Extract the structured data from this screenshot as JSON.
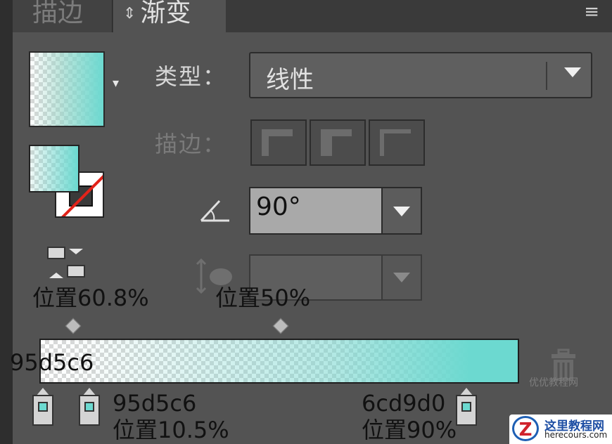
{
  "tabs": {
    "stroke": "描边",
    "gradient": "渐变",
    "gradient_arrows": "⇕"
  },
  "panel_menu_icon": "≡",
  "colors": {
    "panel_bg": "#535353",
    "tab_bg": "#3a3a3a",
    "gradient_start": "#95d5c6",
    "gradient_end": "#6cd9d0",
    "none_slash": "#e2231a"
  },
  "labels": {
    "type": "类型：",
    "stroke": "描边：",
    "swatch_dropdown_arrow": "▾"
  },
  "type_select": {
    "value": "线性"
  },
  "angle": {
    "value": "90°"
  },
  "annotations": {
    "pos_608": "位置60.8%",
    "pos_50": "位置50%",
    "left_color": "95d5c6",
    "stop1_color": "95d5c6",
    "stop1_pos": "位置10.5%",
    "stop3_color": "6cd9d0",
    "stop3_pos": "位置90%"
  },
  "gradient": {
    "stops": [
      {
        "color": "#95d5c6",
        "position": 0.0,
        "opacity": 0
      },
      {
        "color": "#95d5c6",
        "position": 0.105,
        "opacity": 0.05
      },
      {
        "color": "#6cd9d0",
        "position": 0.9,
        "opacity": 1
      }
    ],
    "midpoints": [
      0.608,
      0.5
    ]
  },
  "watermark": {
    "logo": "Z",
    "title": "这里教程网",
    "url": "herecours.com",
    "left_text": "优优教程网"
  }
}
